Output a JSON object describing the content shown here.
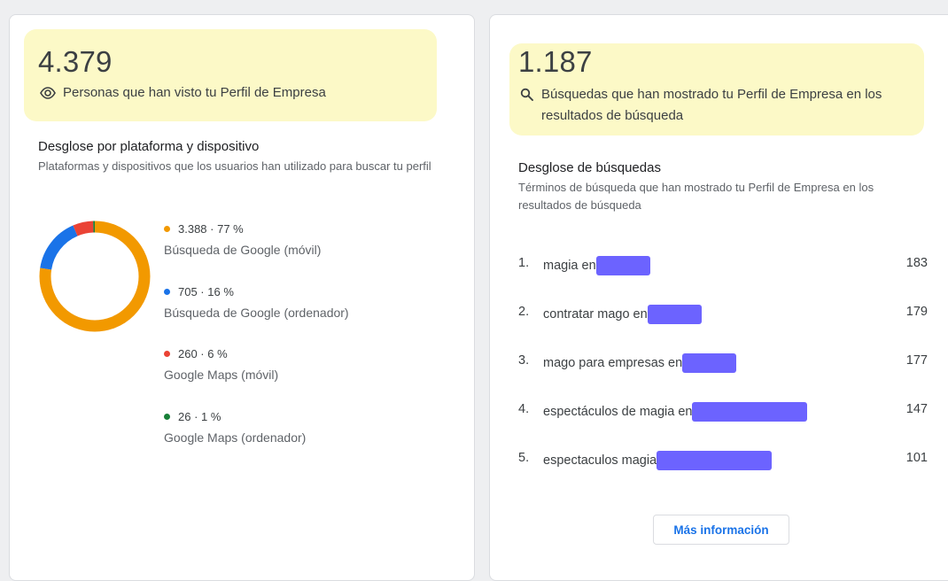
{
  "left_card": {
    "views_count": "4.379",
    "views_caption": "Personas que han visto tu Perfil de Empresa",
    "breakdown_title": "Desglose por plataforma y dispositivo",
    "breakdown_subtitle": "Plataformas y dispositivos que los usuarios han utilizado para buscar tu perfil",
    "legend": [
      {
        "value": "3.388 · 77 %",
        "label": "Búsqueda de Google (móvil)",
        "color": "#f29900"
      },
      {
        "value": "705 · 16 %",
        "label": "Búsqueda de Google (ordenador)",
        "color": "#1a73e8"
      },
      {
        "value": "260 · 6 %",
        "label": "Google Maps (móvil)",
        "color": "#ea4335"
      },
      {
        "value": "26 · 1 %",
        "label": "Google Maps (ordenador)",
        "color": "#188038"
      }
    ]
  },
  "chart_data": {
    "type": "pie",
    "categories": [
      "Búsqueda de Google (móvil)",
      "Búsqueda de Google (ordenador)",
      "Google Maps (móvil)",
      "Google Maps (ordenador)"
    ],
    "values": [
      3388,
      705,
      260,
      26
    ],
    "percentages": [
      77,
      16,
      6,
      1
    ],
    "colors": [
      "#f29900",
      "#1a73e8",
      "#ea4335",
      "#188038"
    ]
  },
  "right_card": {
    "searches_count": "1.187",
    "searches_caption": "Búsquedas que han mostrado tu Perfil de Empresa en los resultados de búsqueda",
    "breakdown_title": "Desglose de búsquedas",
    "breakdown_subtitle": "Términos de búsqueda que han mostrado tu Perfil de Empresa en los resultados de búsqueda",
    "searches": [
      {
        "rank": "1.",
        "term": "magia en",
        "count": "183"
      },
      {
        "rank": "2.",
        "term": "contratar mago en",
        "count": "179"
      },
      {
        "rank": "3.",
        "term": "mago para empresas en",
        "count": "177"
      },
      {
        "rank": "4.",
        "term": "espectáculos de magia en",
        "count": "147"
      },
      {
        "rank": "5.",
        "term": "espectaculos magia",
        "count": "101"
      }
    ],
    "more_button": "Más información"
  },
  "icons": {
    "views": "eye-icon",
    "searches": "search-icon"
  },
  "colors": {
    "highlight": "#fcf9c7",
    "accent": "#1a73e8",
    "redaction": "#6c63ff"
  }
}
